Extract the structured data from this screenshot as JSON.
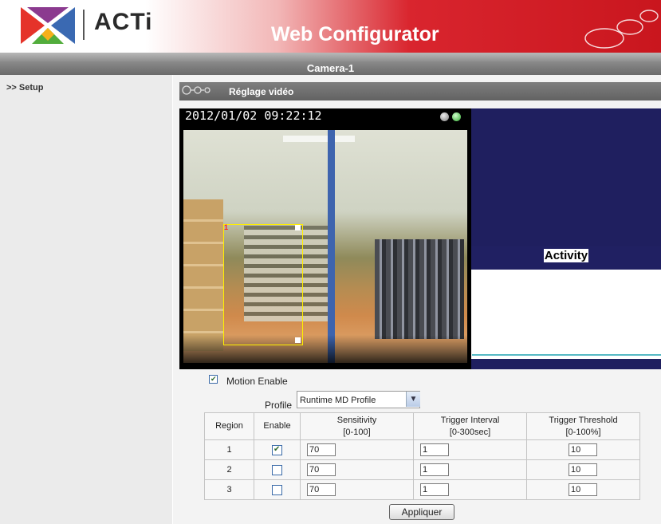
{
  "header": {
    "logo_text": "ACTi",
    "app_title": "Web Configurator"
  },
  "camera": {
    "name": "Camera-1"
  },
  "sidebar": {
    "setup_label": ">> Setup"
  },
  "section": {
    "title": "Réglage vidéo"
  },
  "video": {
    "timestamp": "2012/01/02 09:22:12",
    "region_label": "1"
  },
  "activity": {
    "label": "Activity"
  },
  "motion": {
    "enable_label": "Motion Enable",
    "enabled": true,
    "profile_label": "Profile",
    "profile_value": "Runtime MD Profile"
  },
  "table": {
    "headers": {
      "region": "Region",
      "enable": "Enable",
      "sensitivity": "Sensitivity",
      "sensitivity_range": "[0-100]",
      "interval": "Trigger Interval",
      "interval_range": "[0-300sec]",
      "threshold": "Trigger Threshold",
      "threshold_range": "[0-100%]"
    },
    "rows": [
      {
        "region": "1",
        "enabled": true,
        "sensitivity": "70",
        "interval": "1",
        "threshold": "10"
      },
      {
        "region": "2",
        "enabled": false,
        "sensitivity": "70",
        "interval": "1",
        "threshold": "10"
      },
      {
        "region": "3",
        "enabled": false,
        "sensitivity": "70",
        "interval": "1",
        "threshold": "10"
      }
    ]
  },
  "buttons": {
    "apply_label": "Appliquer"
  },
  "colors": {
    "brand_red": "#c9161e",
    "activity_bg": "#1f1f5f",
    "activity_line": "#56b9c4",
    "region_outline": "#ffef00"
  }
}
